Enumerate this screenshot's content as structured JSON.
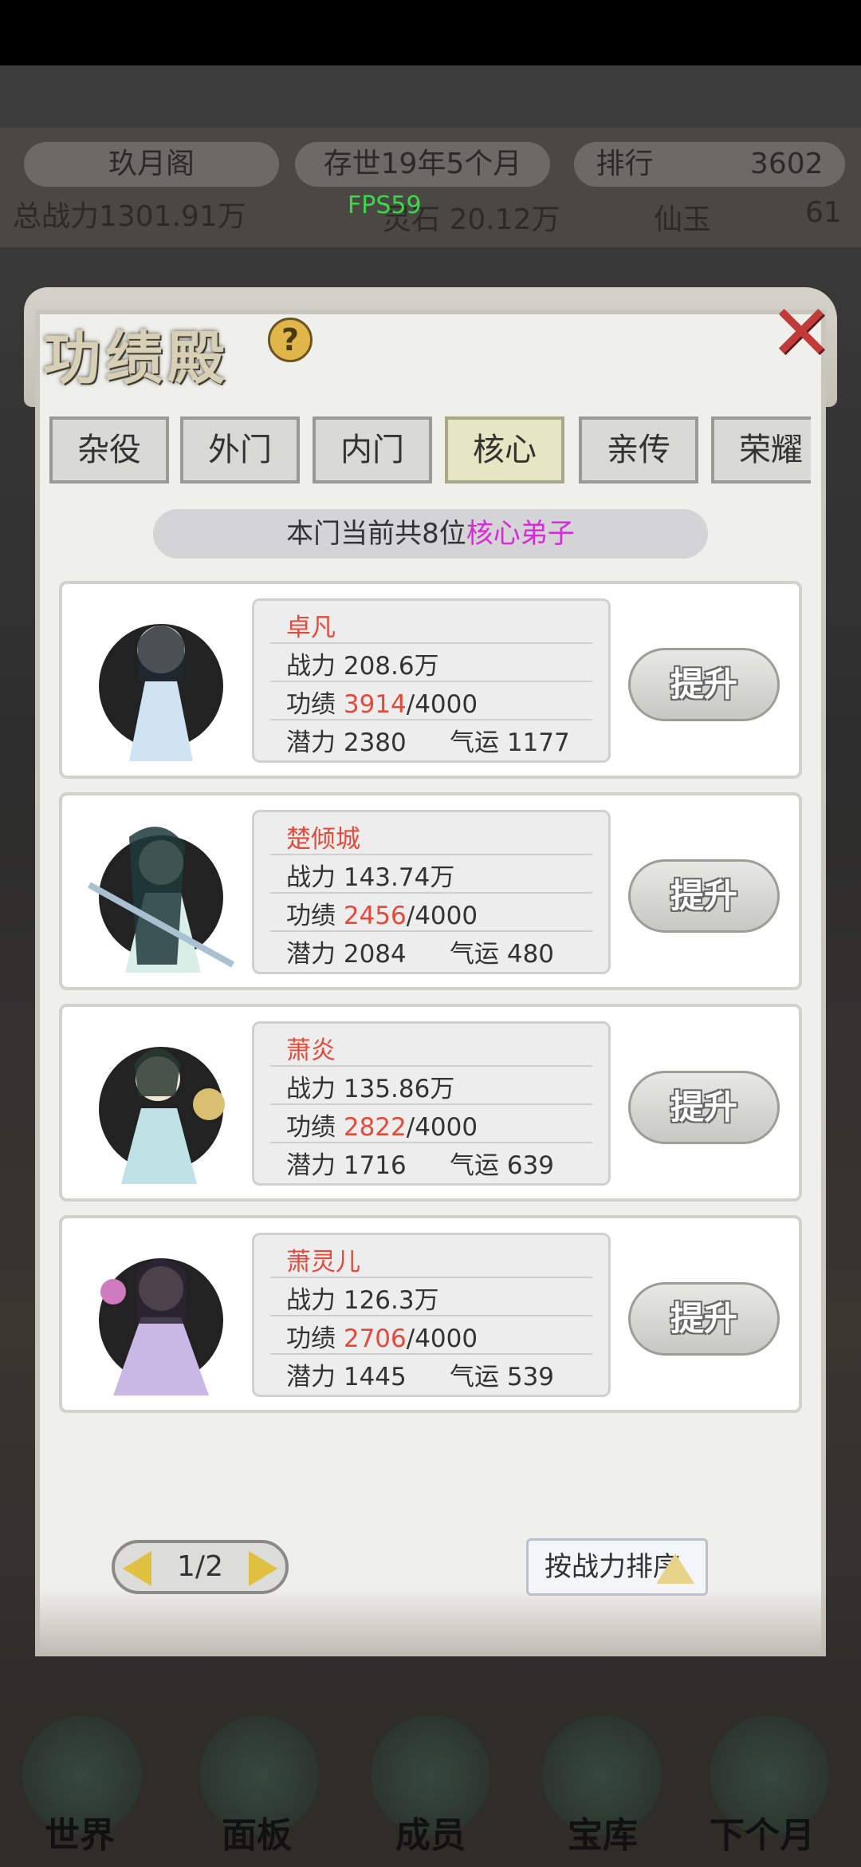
{
  "top": {
    "sect_name": "玖月阁",
    "time": "存世19年5个月",
    "rank_label": "排行",
    "rank_value": "3602",
    "power": "总战力1301.91万",
    "stone": "灵石 20.12万",
    "jade_label": "仙玉",
    "jade_value": "61",
    "fps": "FPS59"
  },
  "modal": {
    "title": "功绩殿",
    "help": "?",
    "tabs": [
      {
        "label": "杂役"
      },
      {
        "label": "外门"
      },
      {
        "label": "内门"
      },
      {
        "label": "核心",
        "active": true
      },
      {
        "label": "亲传"
      },
      {
        "label": "荣耀"
      }
    ],
    "count_prefix": "本门当前共8位",
    "count_highlight": "核心弟子",
    "disciples": [
      {
        "name": "卓凡",
        "power": "战力 208.6万",
        "merit_label": "功绩 ",
        "merit_value": "3914",
        "merit_max": "/4000",
        "potential": "潜力 2380",
        "luck": "气运 1177",
        "button": "提升"
      },
      {
        "name": "楚倾城",
        "power": "战力 143.74万",
        "merit_label": "功绩 ",
        "merit_value": "2456",
        "merit_max": "/4000",
        "potential": "潜力 2084",
        "luck": "气运 480",
        "button": "提升"
      },
      {
        "name": "萧炎",
        "power": "战力 135.86万",
        "merit_label": "功绩 ",
        "merit_value": "2822",
        "merit_max": "/4000",
        "potential": "潜力 1716",
        "luck": "气运 639",
        "button": "提升"
      },
      {
        "name": "萧灵儿",
        "power": "战力 126.3万",
        "merit_label": "功绩 ",
        "merit_value": "2706",
        "merit_max": "/4000",
        "potential": "潜力 1445",
        "luck": "气运 539",
        "button": "提升"
      }
    ],
    "pager": "1/2",
    "sort_label": "按战力排序"
  },
  "nav": [
    "世界",
    "面板",
    "成员",
    "宝库",
    "下个月"
  ]
}
